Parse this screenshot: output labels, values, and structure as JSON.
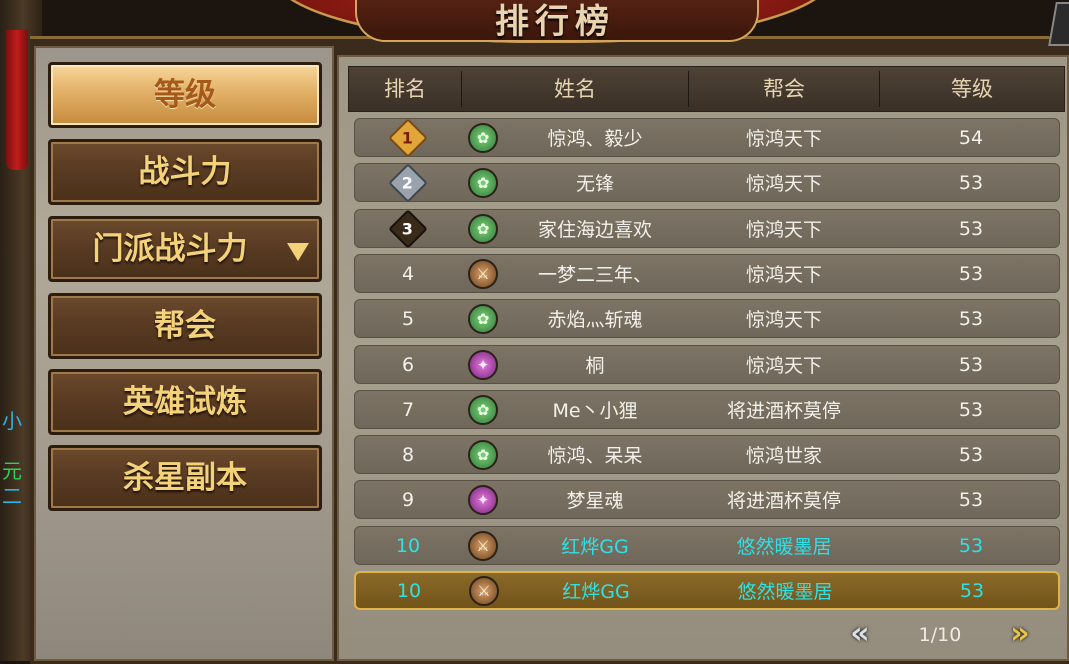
{
  "title": "排行榜",
  "left_edge_text": [
    "小",
    "元",
    "二"
  ],
  "menu": [
    {
      "label": "等级",
      "active": true
    },
    {
      "label": "战斗力",
      "active": false
    },
    {
      "label": "门派战斗力",
      "active": false,
      "has_dropdown": true
    },
    {
      "label": "帮会",
      "active": false
    },
    {
      "label": "英雄试炼",
      "active": false
    },
    {
      "label": "杀星副本",
      "active": false
    }
  ],
  "table": {
    "headers": [
      "排名",
      "姓名",
      "帮会",
      "等级"
    ],
    "rows": [
      {
        "rank": "1",
        "icon": "green-class-icon",
        "name": "惊鸿、毅少",
        "guild": "惊鸿天下",
        "level": "54"
      },
      {
        "rank": "2",
        "icon": "green-class-icon",
        "name": "无锋",
        "guild": "惊鸿天下",
        "level": "53"
      },
      {
        "rank": "3",
        "icon": "green-class-icon",
        "name": "家住海边喜欢",
        "guild": "惊鸿天下",
        "level": "53"
      },
      {
        "rank": "4",
        "icon": "bronze-class-icon",
        "name": "一梦二三年、",
        "guild": "惊鸿天下",
        "level": "53"
      },
      {
        "rank": "5",
        "icon": "green-class-icon",
        "name": "赤焰灬斩魂",
        "guild": "惊鸿天下",
        "level": "53"
      },
      {
        "rank": "6",
        "icon": "purple-class-icon",
        "name": "桐",
        "guild": "惊鸿天下",
        "level": "53"
      },
      {
        "rank": "7",
        "icon": "green-class-icon",
        "name": "Me丶小狸",
        "guild": "将进酒杯莫停",
        "level": "53"
      },
      {
        "rank": "8",
        "icon": "green-class-icon",
        "name": "惊鸿、呆呆",
        "guild": "惊鸿世家",
        "level": "53"
      },
      {
        "rank": "9",
        "icon": "purple-class-icon",
        "name": "梦星魂",
        "guild": "将进酒杯莫停",
        "level": "53"
      },
      {
        "rank": "10",
        "icon": "bronze-class-icon",
        "name": "红烨GG",
        "guild": "悠然暖墨居",
        "level": "53",
        "self": true
      },
      {
        "rank": "10",
        "icon": "bronze-class-icon",
        "name": "红烨GG",
        "guild": "悠然暖墨居",
        "level": "53",
        "self": true,
        "selected": true
      }
    ]
  },
  "pager": {
    "prev_icon": "double-chevron-left-icon",
    "next_icon": "double-chevron-right-icon",
    "prev_glyph": "«",
    "next_glyph": "»",
    "page": "1/10"
  },
  "colors": {
    "menu_text": "#f3d27a",
    "self_text": "#2fe0e6",
    "selected_border": "#e2b34a"
  }
}
